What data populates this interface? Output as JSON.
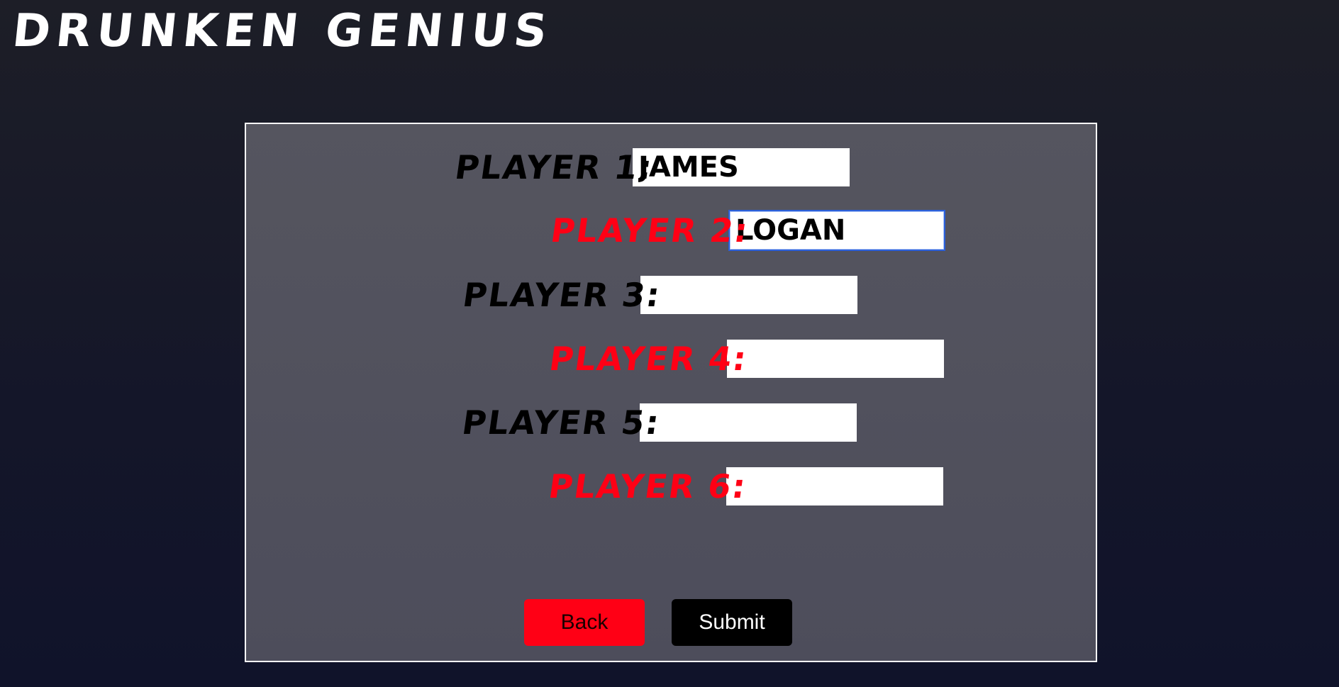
{
  "app": {
    "title": "DRUNKEN GENIUS"
  },
  "form": {
    "players": [
      {
        "label": "PLAYER 1:",
        "value": "JAMES",
        "color": "dark",
        "focused": false
      },
      {
        "label": "PLAYER 2:",
        "value": "LOGAN",
        "color": "red",
        "focused": true
      },
      {
        "label": "PLAYER 3:",
        "value": "",
        "color": "dark",
        "focused": false
      },
      {
        "label": "PLAYER 4:",
        "value": "",
        "color": "red",
        "focused": false
      },
      {
        "label": "PLAYER 5:",
        "value": "",
        "color": "dark",
        "focused": false
      },
      {
        "label": "PLAYER 6:",
        "value": "",
        "color": "red",
        "focused": false
      }
    ],
    "back_label": "Back",
    "submit_label": "Submit"
  },
  "colors": {
    "accent_red": "#ff0015",
    "panel_gray": "#52525c",
    "focus_blue": "#2b5fd9"
  }
}
